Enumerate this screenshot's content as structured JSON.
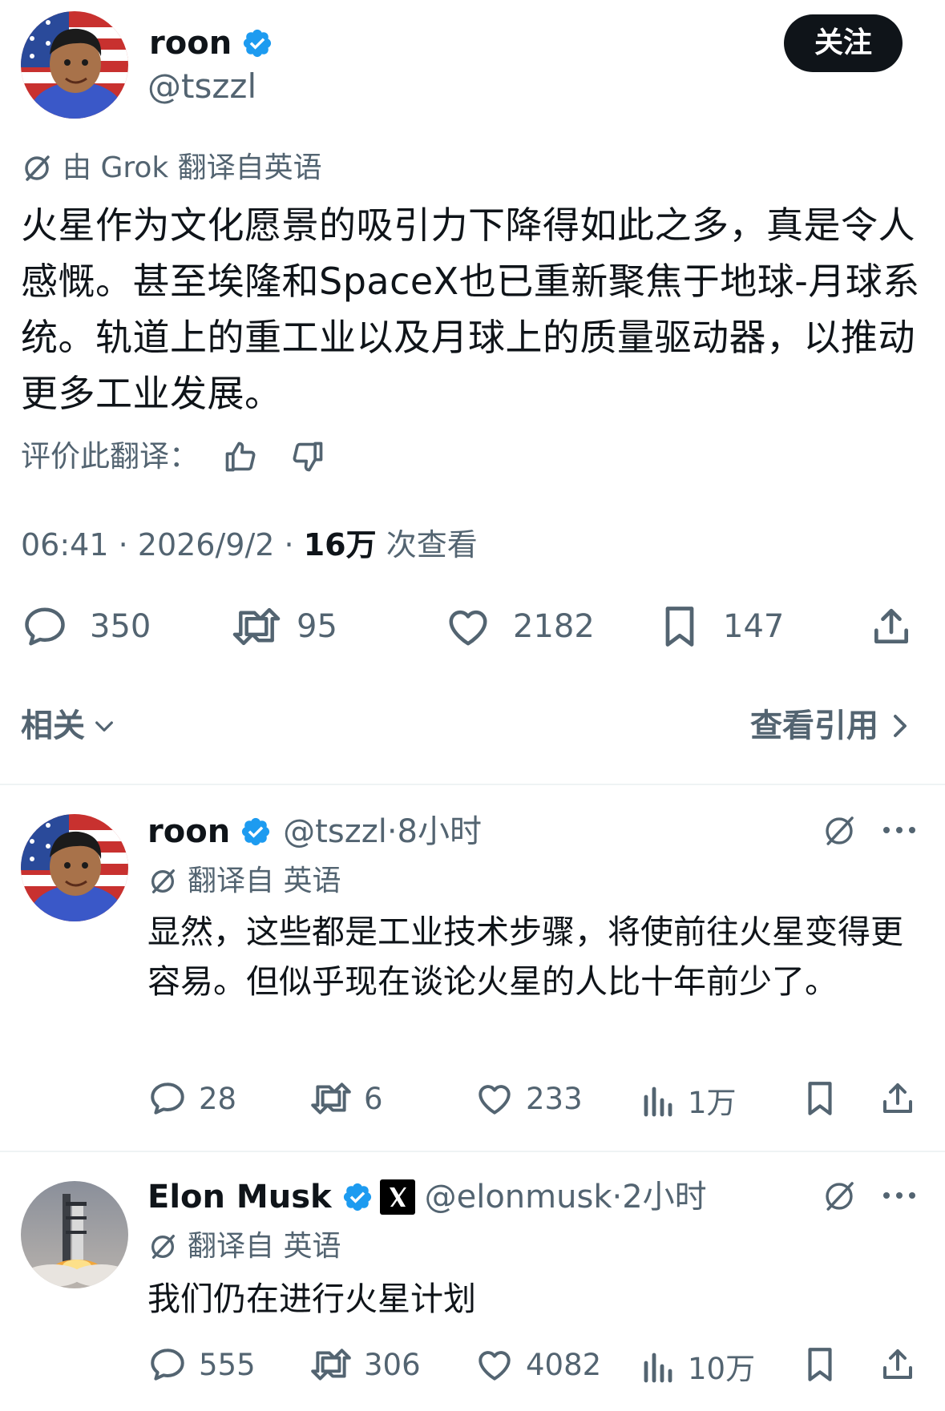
{
  "main_tweet": {
    "author_name": "roon",
    "author_handle": "@tszzl",
    "follow_label": "关注",
    "translated_label": "由 Grok 翻译自英语",
    "text": "火星作为文化愿景的吸引力下降得如此之多，真是令人感慨。甚至埃隆和SpaceX也已重新聚焦于地球-月球系统。轨道上的重工业以及月球上的质量驱动器，以推动更多工业发展。",
    "rate_label": "评价此翻译：",
    "time": "06:41",
    "date": "2026/9/2",
    "views_count": "16万",
    "views_label": "次查看",
    "stats": {
      "replies": "350",
      "retweets": "95",
      "likes": "2182",
      "bookmarks": "147"
    },
    "related_label": "相关",
    "view_quotes_label": "查看引用"
  },
  "replies": [
    {
      "author_name": "roon",
      "author_handle": "@tszzl",
      "time_ago": "8小时",
      "translated_label": "翻译自 英语",
      "text": "显然，这些都是工业技术步骤，将使前往火星变得更容易。但似乎现在谈论火星的人比十年前少了。",
      "stats": {
        "replies": "28",
        "retweets": "6",
        "likes": "233",
        "views": "1万"
      }
    },
    {
      "author_name": "Elon Musk",
      "author_handle": "@elonmusk",
      "time_ago": "2小时",
      "translated_label": "翻译自 英语",
      "text": "我们仍在进行火星计划",
      "stats": {
        "replies": "555",
        "retweets": "306",
        "likes": "4082",
        "views": "10万"
      }
    }
  ],
  "icons": {
    "reply": "speech-bubble-icon",
    "retweet": "retweet-icon",
    "like": "heart-icon",
    "bookmark": "bookmark-icon",
    "share": "share-icon",
    "views": "bar-chart-icon",
    "translate": "translate-icon",
    "more": "more-icon",
    "verified": "verified-badge-icon"
  },
  "colors": {
    "text": "#0f1419",
    "secondary": "#536471",
    "verified": "#1d9bf0",
    "button_bg": "#0f1419"
  }
}
